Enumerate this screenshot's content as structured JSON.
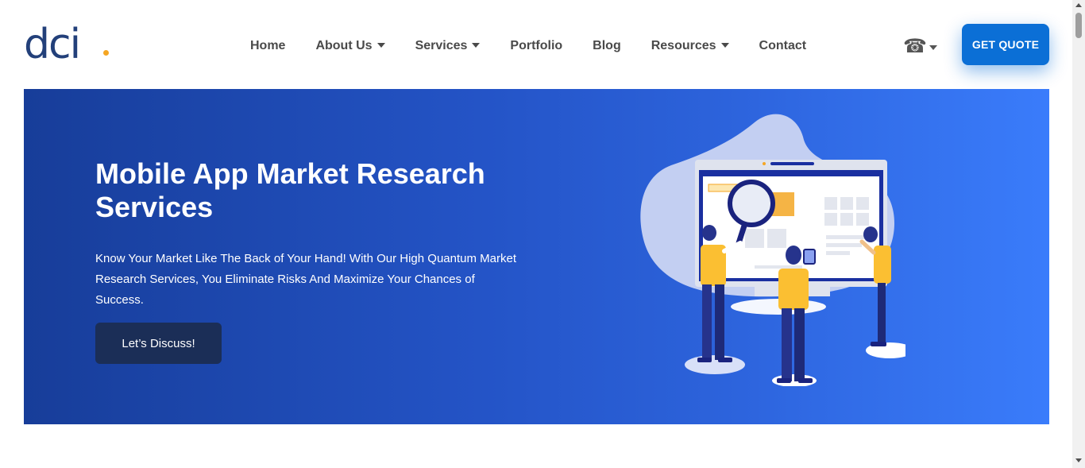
{
  "logo": {
    "text": "dci",
    "accent_color": "#f5a623",
    "color": "#23407a"
  },
  "nav": {
    "items": [
      {
        "label": "Home",
        "has_dropdown": false
      },
      {
        "label": "About Us",
        "has_dropdown": true
      },
      {
        "label": "Services",
        "has_dropdown": true
      },
      {
        "label": "Portfolio",
        "has_dropdown": false
      },
      {
        "label": "Blog",
        "has_dropdown": false
      },
      {
        "label": "Resources",
        "has_dropdown": true
      },
      {
        "label": "Contact",
        "has_dropdown": false
      }
    ],
    "phone_icon": "telephone-icon",
    "phone_glyph": "☎"
  },
  "cta": {
    "quote_label": "GET QUOTE",
    "color": "#0b6fd6"
  },
  "hero": {
    "title": "Mobile App Market Research Services",
    "text": "Know Your Market Like The Back of Your Hand! With Our High Quantum Market Research Services, You Eliminate Risks And Maximize Your Chances of Success.",
    "button_label": "Let’s Discuss!",
    "gradient_start": "#173d99",
    "gradient_end": "#3a7cfb",
    "button_color": "#1b2e57",
    "illustration": "market-research-illustration"
  }
}
